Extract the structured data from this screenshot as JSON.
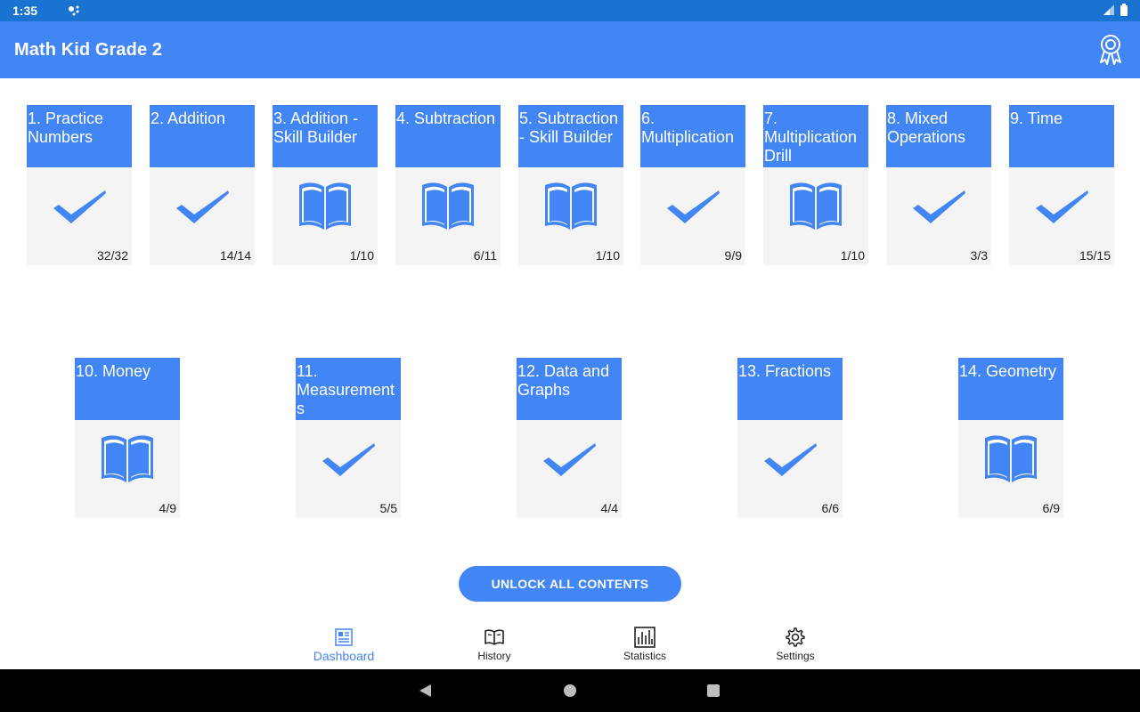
{
  "status_bar": {
    "time": "1:35"
  },
  "app_bar": {
    "title": "Math Kid Grade 2",
    "award_icon": "award-ribbon-icon"
  },
  "cards": [
    {
      "title": "1. Practice Numbers",
      "status": "completed",
      "icon": "checkmark-icon",
      "progress": "32/32"
    },
    {
      "title": "2. Addition",
      "status": "completed",
      "icon": "checkmark-icon",
      "progress": "14/14"
    },
    {
      "title": "3. Addition - Skill Builder",
      "status": "in-progress",
      "icon": "book-icon",
      "progress": "1/10"
    },
    {
      "title": "4. Subtraction",
      "status": "in-progress",
      "icon": "book-icon",
      "progress": "6/11"
    },
    {
      "title": "5. Subtraction - Skill Builder",
      "status": "in-progress",
      "icon": "book-icon",
      "progress": "1/10"
    },
    {
      "title": "6. Multiplication",
      "status": "completed",
      "icon": "checkmark-icon",
      "progress": "9/9"
    },
    {
      "title": "7. Multiplication Drill",
      "status": "in-progress",
      "icon": "book-icon",
      "progress": "1/10"
    },
    {
      "title": "8. Mixed Operations",
      "status": "completed",
      "icon": "checkmark-icon",
      "progress": "3/3"
    },
    {
      "title": "9. Time",
      "status": "completed",
      "icon": "checkmark-icon",
      "progress": "15/15"
    },
    {
      "title": "10. Money",
      "status": "in-progress",
      "icon": "book-icon",
      "progress": "4/9"
    },
    {
      "title": "11. Measurements",
      "status": "completed",
      "icon": "checkmark-icon",
      "progress": "5/5"
    },
    {
      "title": "12. Data and Graphs",
      "status": "completed",
      "icon": "checkmark-icon",
      "progress": "4/4"
    },
    {
      "title": "13. Fractions",
      "status": "completed",
      "icon": "checkmark-icon",
      "progress": "6/6"
    },
    {
      "title": "14. Geometry",
      "status": "in-progress",
      "icon": "book-icon",
      "progress": "6/9"
    }
  ],
  "unlock_button": {
    "label": "UNLOCK ALL CONTENTS"
  },
  "bottom_nav": {
    "items": [
      {
        "label": "Dashboard",
        "icon": "dashboard-icon",
        "active": true
      },
      {
        "label": "History",
        "icon": "open-book-icon",
        "active": false
      },
      {
        "label": "Statistics",
        "icon": "bar-chart-icon",
        "active": false
      },
      {
        "label": "Settings",
        "icon": "gear-icon",
        "active": false
      }
    ]
  },
  "colors": {
    "primary": "#4285f4",
    "status_bar": "#1a73d0",
    "card_body": "#f4f4f4",
    "nav_bar": "#000000"
  }
}
